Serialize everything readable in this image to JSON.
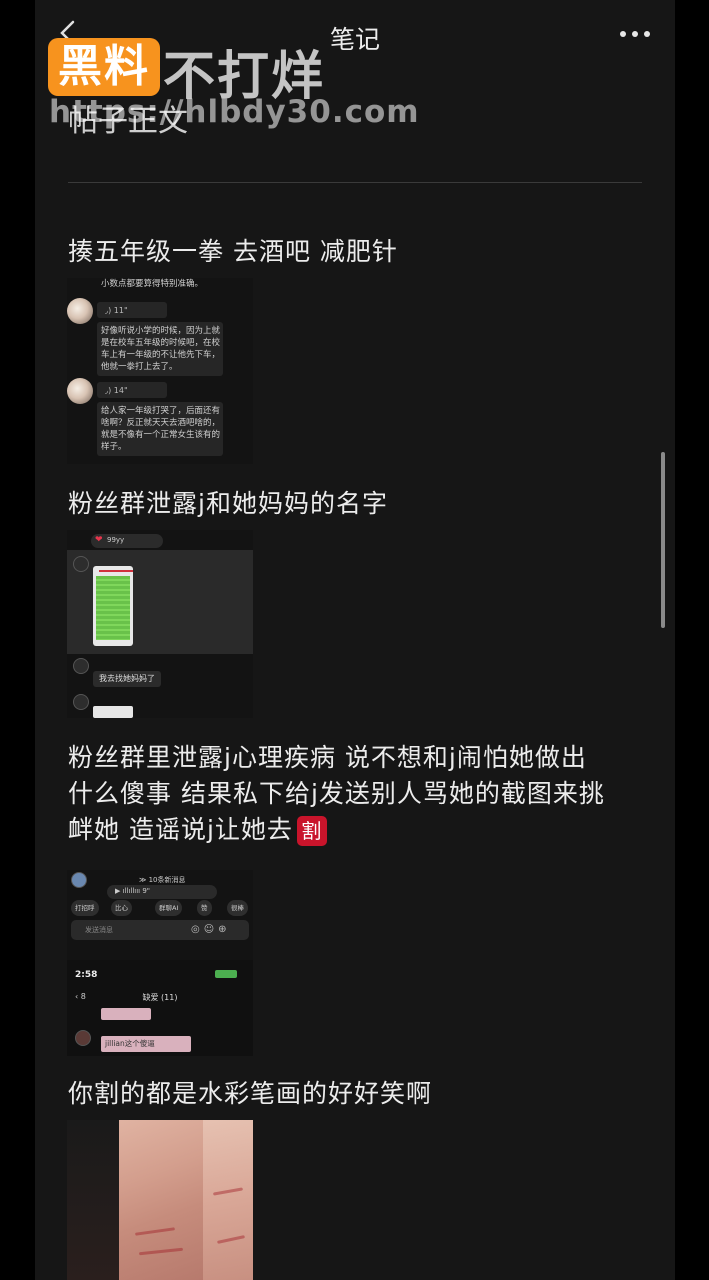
{
  "header": {
    "title": "笔记",
    "back_icon": "chevron-left-icon",
    "more_icon": "more-dots-icon"
  },
  "subtitle": "帖子正文",
  "watermark": {
    "badge": "黑料",
    "text": "不打烊",
    "url": "https://hlbdy30.com"
  },
  "sections": [
    {
      "text": "揍五年级一拳 去酒吧 减肥针",
      "shot": {
        "top_line": "小数点都要算得特别准确。",
        "voice1": "11\"",
        "msg1": [
          "好像听说小学的时候，因为上就",
          "是在校车五年级的时候吧，在校",
          "车上有一年级的不让他先下车，",
          "他就一拳打上去了。"
        ],
        "voice2": "14\"",
        "msg2": [
          "给人家一年级打哭了，后面还有",
          "啥啊？反正就天天去酒吧啥的，",
          "就是不像有一个正常女生该有的",
          "样子。"
        ]
      }
    },
    {
      "text": "粉丝群泄露j和她妈妈的名字",
      "shot": {
        "top_tag": "99yy",
        "msg": "我去找她妈妈了"
      }
    },
    {
      "text_lines": [
        "粉丝群里泄露j心理疾病 说不想和j闹怕她做出",
        "什么傻事 结果私下给j发送别人骂她的截图来挑",
        "衅她 造谣说j让她去"
      ],
      "emoji": "割",
      "shot": {
        "new_msgs": "10条新消息",
        "voice": "9\"",
        "chips": [
          "打招呼",
          "比心",
          "群聊AI",
          "赞",
          "很棒"
        ],
        "input_placeholder": "发送消息",
        "status_time": "2:58",
        "chat_name": "缺爱 (11)",
        "back_count": "8",
        "msg": "jillian这个傻逼"
      }
    },
    {
      "text": "你割的都是水彩笔画的好好笑啊"
    }
  ]
}
